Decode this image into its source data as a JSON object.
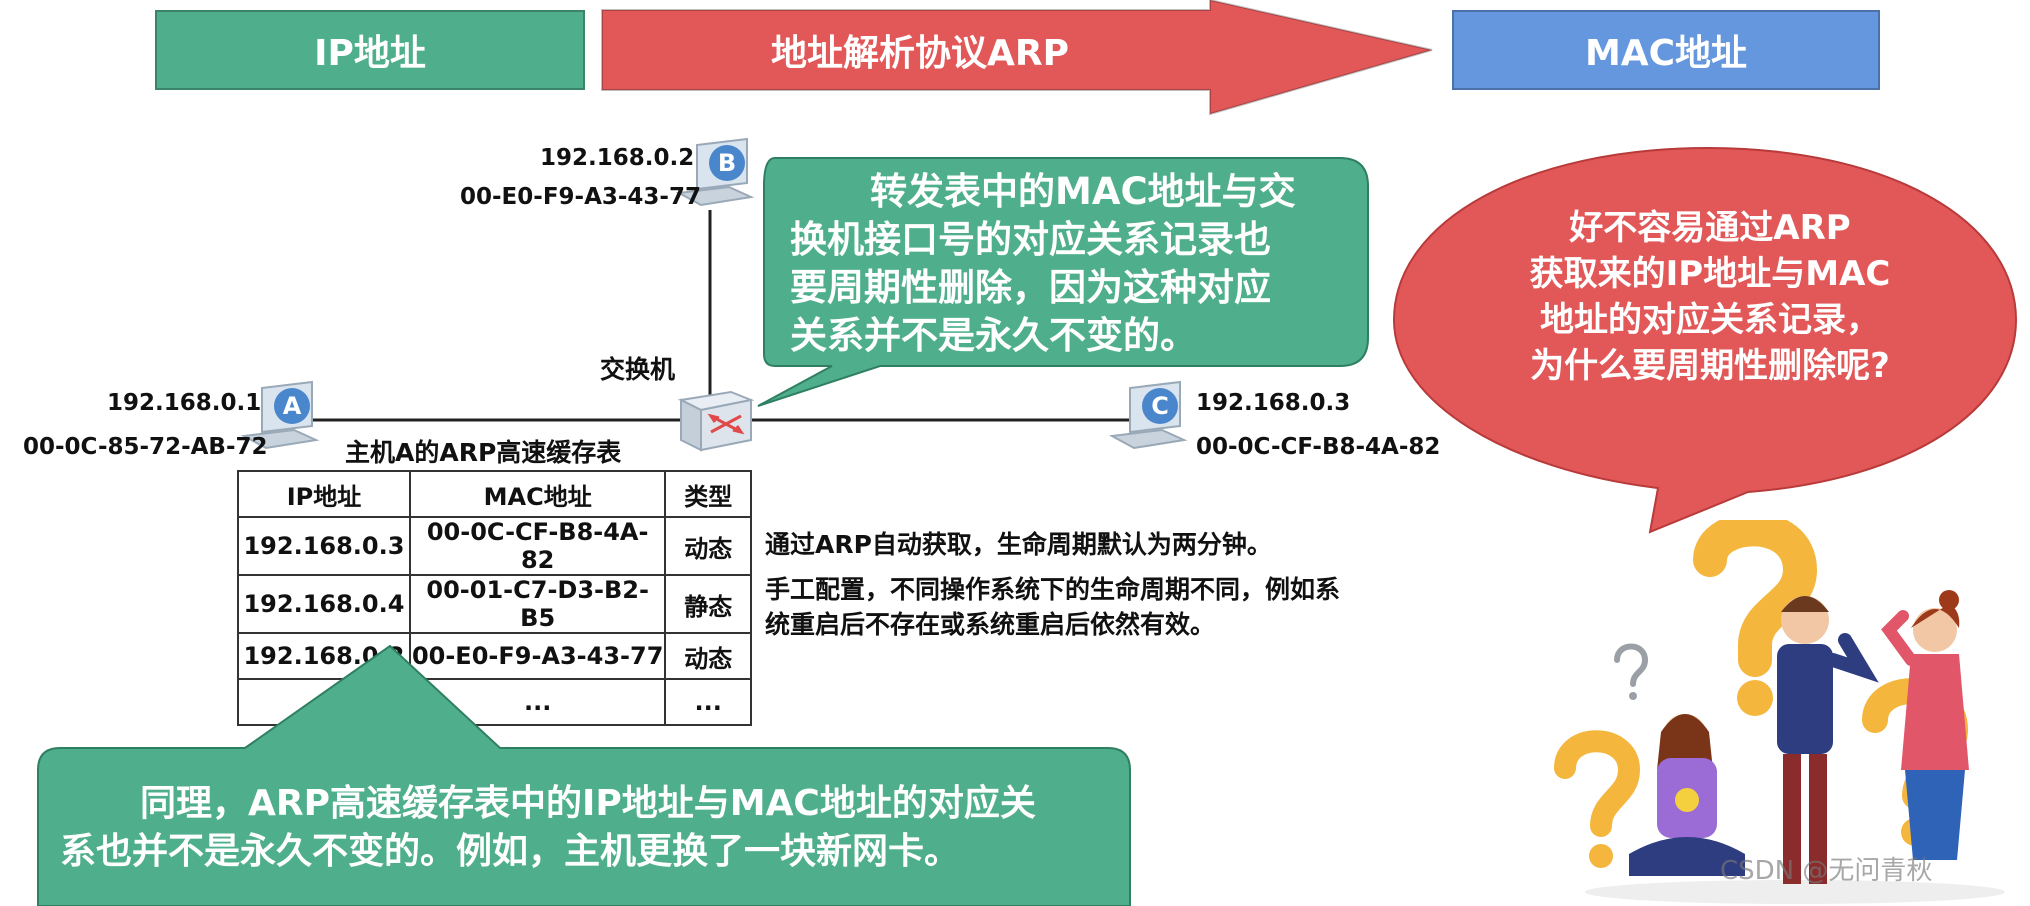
{
  "banners": {
    "ip": "IP地址",
    "arp": "地址解析协议ARP",
    "mac": "MAC地址"
  },
  "hosts": {
    "b": {
      "letter": "B",
      "ip": "192.168.0.2",
      "mac": "00-E0-F9-A3-43-77"
    },
    "a": {
      "letter": "A",
      "ip": "192.168.0.1",
      "mac": "00-0C-85-72-AB-72"
    },
    "c": {
      "letter": "C",
      "ip": "192.168.0.3",
      "mac": "00-0C-CF-B8-4A-82"
    },
    "switch_label": "交换机"
  },
  "green_bubble_top": {
    "lines": [
      "转发表中的MAC地址与交",
      "换机接口号的对应关系记录也",
      "要周期性删除，因为这种对应",
      "关系并不是永久不变的。"
    ]
  },
  "red_bubble": {
    "lines": [
      "好不容易通过ARP",
      "获取来的IP地址与MAC",
      "地址的对应关系记录，",
      "为什么要周期性删除呢?"
    ]
  },
  "arp_table": {
    "title": "主机A的ARP高速缓存表",
    "headers": [
      "IP地址",
      "MAC地址",
      "类型"
    ],
    "rows": [
      [
        "192.168.0.3",
        "00-0C-CF-B8-4A-82",
        "动态"
      ],
      [
        "192.168.0.4",
        "00-01-C7-D3-B2-B5",
        "静态"
      ],
      [
        "192.168.0.2",
        "00-E0-F9-A3-43-77",
        "动态"
      ],
      [
        "...",
        "...",
        "..."
      ]
    ]
  },
  "notes": {
    "dynamic": "通过ARP自动获取，生命周期默认为两分钟。",
    "static_line1": "手工配置，不同操作系统下的生命周期不同，例如系",
    "static_line2": "统重启后不存在或系统重启后依然有效。"
  },
  "green_bubble_bottom": {
    "line1": "同理，ARP高速缓存表中的IP地址与MAC地址的对应关",
    "line2": "系也并不是永久不变的。例如，主机更换了一块新网卡。"
  },
  "watermark": "CSDN @无问青秋",
  "colors": {
    "green": "#4faf8c",
    "red": "#e25858",
    "blue": "#6497de",
    "question": "#f4b63c"
  }
}
